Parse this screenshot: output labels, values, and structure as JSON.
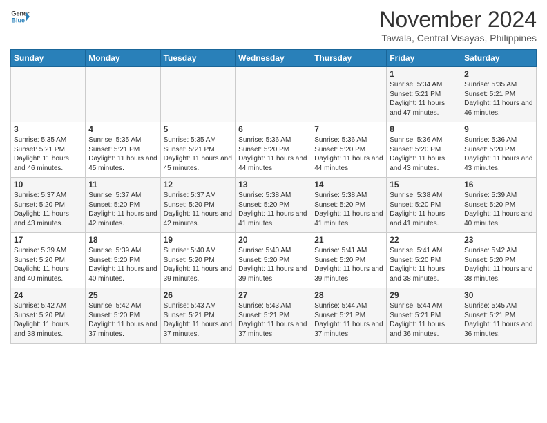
{
  "header": {
    "logo_line1": "General",
    "logo_line2": "Blue",
    "month": "November 2024",
    "location": "Tawala, Central Visayas, Philippines"
  },
  "weekdays": [
    "Sunday",
    "Monday",
    "Tuesday",
    "Wednesday",
    "Thursday",
    "Friday",
    "Saturday"
  ],
  "weeks": [
    [
      {
        "day": "",
        "info": ""
      },
      {
        "day": "",
        "info": ""
      },
      {
        "day": "",
        "info": ""
      },
      {
        "day": "",
        "info": ""
      },
      {
        "day": "",
        "info": ""
      },
      {
        "day": "1",
        "info": "Sunrise: 5:34 AM\nSunset: 5:21 PM\nDaylight: 11 hours and 47 minutes."
      },
      {
        "day": "2",
        "info": "Sunrise: 5:35 AM\nSunset: 5:21 PM\nDaylight: 11 hours and 46 minutes."
      }
    ],
    [
      {
        "day": "3",
        "info": "Sunrise: 5:35 AM\nSunset: 5:21 PM\nDaylight: 11 hours and 46 minutes."
      },
      {
        "day": "4",
        "info": "Sunrise: 5:35 AM\nSunset: 5:21 PM\nDaylight: 11 hours and 45 minutes."
      },
      {
        "day": "5",
        "info": "Sunrise: 5:35 AM\nSunset: 5:21 PM\nDaylight: 11 hours and 45 minutes."
      },
      {
        "day": "6",
        "info": "Sunrise: 5:36 AM\nSunset: 5:20 PM\nDaylight: 11 hours and 44 minutes."
      },
      {
        "day": "7",
        "info": "Sunrise: 5:36 AM\nSunset: 5:20 PM\nDaylight: 11 hours and 44 minutes."
      },
      {
        "day": "8",
        "info": "Sunrise: 5:36 AM\nSunset: 5:20 PM\nDaylight: 11 hours and 43 minutes."
      },
      {
        "day": "9",
        "info": "Sunrise: 5:36 AM\nSunset: 5:20 PM\nDaylight: 11 hours and 43 minutes."
      }
    ],
    [
      {
        "day": "10",
        "info": "Sunrise: 5:37 AM\nSunset: 5:20 PM\nDaylight: 11 hours and 43 minutes."
      },
      {
        "day": "11",
        "info": "Sunrise: 5:37 AM\nSunset: 5:20 PM\nDaylight: 11 hours and 42 minutes."
      },
      {
        "day": "12",
        "info": "Sunrise: 5:37 AM\nSunset: 5:20 PM\nDaylight: 11 hours and 42 minutes."
      },
      {
        "day": "13",
        "info": "Sunrise: 5:38 AM\nSunset: 5:20 PM\nDaylight: 11 hours and 41 minutes."
      },
      {
        "day": "14",
        "info": "Sunrise: 5:38 AM\nSunset: 5:20 PM\nDaylight: 11 hours and 41 minutes."
      },
      {
        "day": "15",
        "info": "Sunrise: 5:38 AM\nSunset: 5:20 PM\nDaylight: 11 hours and 41 minutes."
      },
      {
        "day": "16",
        "info": "Sunrise: 5:39 AM\nSunset: 5:20 PM\nDaylight: 11 hours and 40 minutes."
      }
    ],
    [
      {
        "day": "17",
        "info": "Sunrise: 5:39 AM\nSunset: 5:20 PM\nDaylight: 11 hours and 40 minutes."
      },
      {
        "day": "18",
        "info": "Sunrise: 5:39 AM\nSunset: 5:20 PM\nDaylight: 11 hours and 40 minutes."
      },
      {
        "day": "19",
        "info": "Sunrise: 5:40 AM\nSunset: 5:20 PM\nDaylight: 11 hours and 39 minutes."
      },
      {
        "day": "20",
        "info": "Sunrise: 5:40 AM\nSunset: 5:20 PM\nDaylight: 11 hours and 39 minutes."
      },
      {
        "day": "21",
        "info": "Sunrise: 5:41 AM\nSunset: 5:20 PM\nDaylight: 11 hours and 39 minutes."
      },
      {
        "day": "22",
        "info": "Sunrise: 5:41 AM\nSunset: 5:20 PM\nDaylight: 11 hours and 38 minutes."
      },
      {
        "day": "23",
        "info": "Sunrise: 5:42 AM\nSunset: 5:20 PM\nDaylight: 11 hours and 38 minutes."
      }
    ],
    [
      {
        "day": "24",
        "info": "Sunrise: 5:42 AM\nSunset: 5:20 PM\nDaylight: 11 hours and 38 minutes."
      },
      {
        "day": "25",
        "info": "Sunrise: 5:42 AM\nSunset: 5:20 PM\nDaylight: 11 hours and 37 minutes."
      },
      {
        "day": "26",
        "info": "Sunrise: 5:43 AM\nSunset: 5:21 PM\nDaylight: 11 hours and 37 minutes."
      },
      {
        "day": "27",
        "info": "Sunrise: 5:43 AM\nSunset: 5:21 PM\nDaylight: 11 hours and 37 minutes."
      },
      {
        "day": "28",
        "info": "Sunrise: 5:44 AM\nSunset: 5:21 PM\nDaylight: 11 hours and 37 minutes."
      },
      {
        "day": "29",
        "info": "Sunrise: 5:44 AM\nSunset: 5:21 PM\nDaylight: 11 hours and 36 minutes."
      },
      {
        "day": "30",
        "info": "Sunrise: 5:45 AM\nSunset: 5:21 PM\nDaylight: 11 hours and 36 minutes."
      }
    ]
  ]
}
